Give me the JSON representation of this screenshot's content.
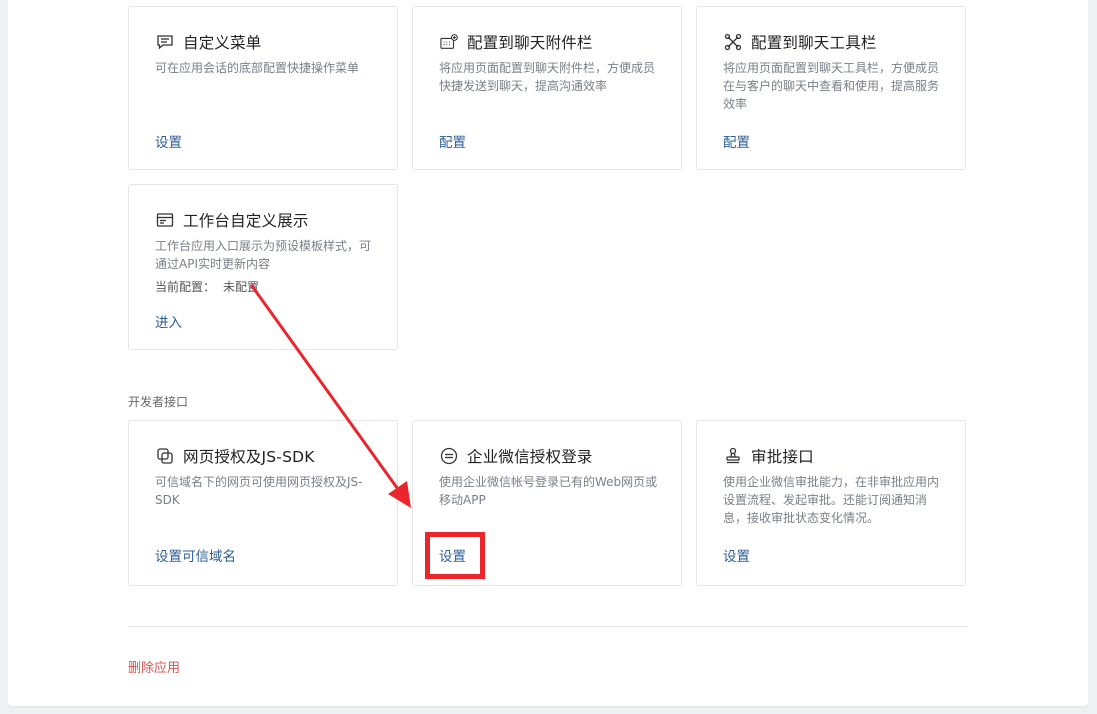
{
  "cards_top": [
    {
      "icon": "chat-menu-icon",
      "title": "自定义菜单",
      "desc": "可在应用会话的底部配置快捷操作菜单",
      "action": "设置"
    },
    {
      "icon": "keyboard-add-icon",
      "title": "配置到聊天附件栏",
      "desc": "将应用页面配置到聊天附件栏，方便成员快捷发送到聊天，提高沟通效率",
      "action": "配置"
    },
    {
      "icon": "tools-icon",
      "title": "配置到聊天工具栏",
      "desc": "将应用页面配置到聊天工具栏，方便成员在与客户的聊天中查看和使用，提高服务效率",
      "action": "配置"
    }
  ],
  "workbench_card": {
    "icon": "workbench-display-icon",
    "title": "工作台自定义展示",
    "desc": "工作台应用入口展示为预设模板样式，可通过API实时更新内容",
    "meta_label": "当前配置：",
    "meta_value": "未配置",
    "action": "进入"
  },
  "developer_section": {
    "label": "开发者接口",
    "cards": [
      {
        "icon": "copy-link-icon",
        "title": "网页授权及JS-SDK",
        "desc": "可信域名下的网页可使用网页授权及JS-SDK",
        "action": "设置可信域名"
      },
      {
        "icon": "wecom-login-icon",
        "title": "企业微信授权登录",
        "desc": "使用企业微信帐号登录已有的Web网页或移动APP",
        "action": "设置"
      },
      {
        "icon": "approval-stamp-icon",
        "title": "审批接口",
        "desc": "使用企业微信审批能力，在非审批应用内设置流程、发起审批。还能订阅通知消息，接收审批状态变化情况。",
        "action": "设置"
      }
    ]
  },
  "footer": {
    "delete_label": "删除应用"
  },
  "colors": {
    "link": "#2d5e94",
    "danger": "#d9534f",
    "annotation": "#e8262b"
  }
}
